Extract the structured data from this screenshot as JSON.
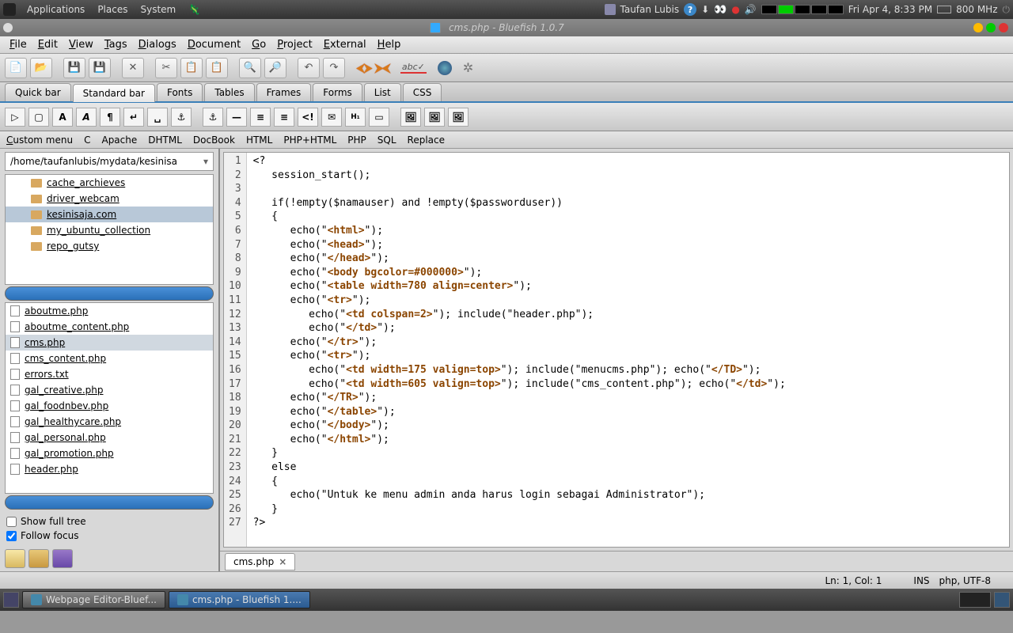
{
  "panel": {
    "apps": "Applications",
    "places": "Places",
    "system": "System",
    "username": "Taufan Lubis",
    "date": "Fri Apr  4,  8:33 PM",
    "cpu": "800 MHz"
  },
  "window": {
    "title": "cms.php - Bluefish 1.0.7"
  },
  "menubar": [
    "File",
    "Edit",
    "View",
    "Tags",
    "Dialogs",
    "Document",
    "Go",
    "Project",
    "External",
    "Help"
  ],
  "tabs": [
    "Quick bar",
    "Standard bar",
    "Fonts",
    "Tables",
    "Frames",
    "Forms",
    "List",
    "CSS"
  ],
  "active_tab": 1,
  "custom_menu": [
    "Custom menu",
    "C",
    "Apache",
    "DHTML",
    "DocBook",
    "HTML",
    "PHP+HTML",
    "PHP",
    "SQL",
    "Replace"
  ],
  "sidebar": {
    "path": "/home/taufanlubis/mydata/kesinisa",
    "folders": [
      {
        "name": "cache_archieves",
        "sel": false
      },
      {
        "name": "driver_webcam",
        "sel": false
      },
      {
        "name": "kesinisaja.com",
        "sel": true
      },
      {
        "name": "my_ubuntu_collection",
        "sel": false
      },
      {
        "name": "repo_gutsy",
        "sel": false
      }
    ],
    "files": [
      "aboutme.php",
      "aboutme_content.php",
      "cms.php",
      "cms_content.php",
      "errors.txt",
      "gal_creative.php",
      "gal_foodnbev.php",
      "gal_healthycare.php",
      "gal_personal.php",
      "gal_promotion.php",
      "header.php"
    ],
    "selected_file": "cms.php",
    "show_full_tree": "Show full tree",
    "follow_focus": "Follow focus",
    "follow_checked": true
  },
  "code_lines": [
    "<?",
    "   session_start();",
    "",
    "   if(!empty($namauser) and !empty($passworduser))",
    "   {",
    "      echo(\"|<html>|\");",
    "      echo(\"|<head>|\");",
    "      echo(\"|</head>|\");",
    "      echo(\"|<body bgcolor=#000000>|\");",
    "      echo(\"|<table width=780 align=center>|\");",
    "      echo(\"|<tr>|\");",
    "         echo(\"|<td colspan=2>|\"); include(\"header.php\");",
    "         echo(\"|</td>|\");",
    "      echo(\"|</tr>|\");",
    "      echo(\"|<tr>|\");",
    "         echo(\"|<td width=175 valign=top>|\"); include(\"menucms.php\"); echo(\"|</TD>|\");",
    "         echo(\"|<td width=605 valign=top>|\"); include(\"cms_content.php\"); echo(\"|</td>|\");",
    "      echo(\"|</TR>|\");",
    "      echo(\"|</table>|\");",
    "      echo(\"|</body>|\");",
    "      echo(\"|</html>|\");",
    "   }",
    "   else",
    "   {",
    "      echo(\"Untuk ke menu admin anda harus login sebagai Administrator\");",
    "   }",
    "?>"
  ],
  "editor_tab": "cms.php",
  "status": {
    "pos": "Ln: 1, Col: 1",
    "ins": "INS",
    "enc": "php, UTF-8"
  },
  "taskbar": [
    {
      "label": "Webpage Editor-Bluef...",
      "active": false
    },
    {
      "label": "cms.php - Bluefish 1....",
      "active": true
    }
  ]
}
